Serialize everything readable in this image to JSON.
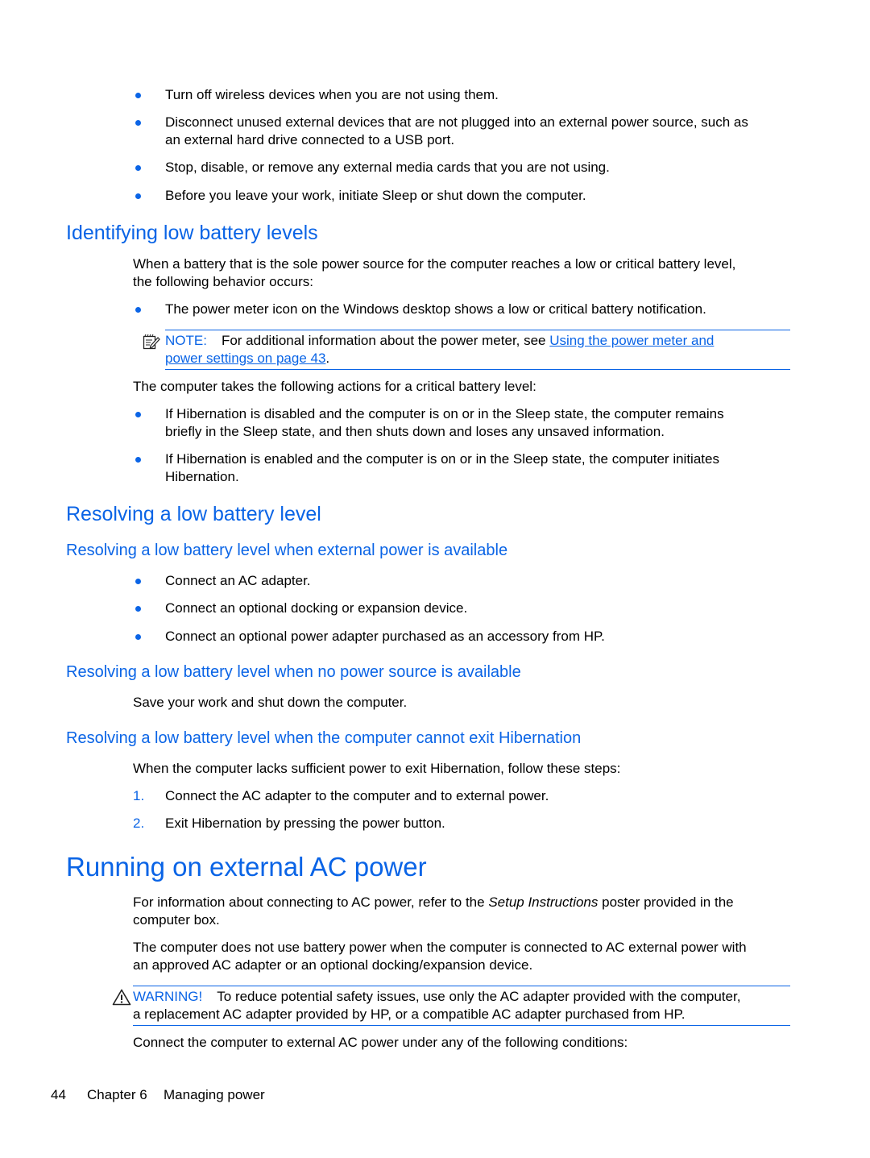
{
  "top_bullets": [
    {
      "lines": [
        "Turn off wireless devices when you are not using them."
      ]
    },
    {
      "lines": [
        "Disconnect unused external devices that are not plugged into an external power source, such as",
        "an external hard drive connected to a USB port."
      ]
    },
    {
      "lines": [
        "Stop, disable, or remove any external media cards that you are not using."
      ]
    },
    {
      "lines": [
        "Before you leave your work, initiate Sleep or shut down the computer."
      ]
    }
  ],
  "section_identifying": {
    "heading": "Identifying low battery levels",
    "intro_lines": [
      "When a battery that is the sole power source for the computer reaches a low or critical battery level,",
      "the following behavior occurs:"
    ],
    "bullets": [
      {
        "lines": [
          "The power meter icon on the Windows desktop shows a low or critical battery notification."
        ]
      }
    ],
    "note": {
      "icon": "note-pencil-icon",
      "label": "NOTE:",
      "text": "For additional information about the power meter, see ",
      "link_line1": "Using the power meter and",
      "link_line2": "power settings on page 43",
      "trailing": "."
    },
    "critical_intro": "The computer takes the following actions for a critical battery level:",
    "critical_bullets": [
      {
        "lines": [
          "If Hibernation is disabled and the computer is on or in the Sleep state, the computer remains",
          "briefly in the Sleep state, and then shuts down and loses any unsaved information."
        ]
      },
      {
        "lines": [
          "If Hibernation is enabled and the computer is on or in the Sleep state, the computer initiates",
          "Hibernation."
        ]
      }
    ]
  },
  "section_resolving": {
    "heading": "Resolving a low battery level",
    "sub_external": {
      "heading": "Resolving a low battery level when external power is available",
      "bullets": [
        {
          "lines": [
            "Connect an AC adapter."
          ]
        },
        {
          "lines": [
            "Connect an optional docking or expansion device."
          ]
        },
        {
          "lines": [
            "Connect an optional power adapter purchased as an accessory from HP."
          ]
        }
      ]
    },
    "sub_no_power": {
      "heading": "Resolving a low battery level when no power source is available",
      "text": "Save your work and shut down the computer."
    },
    "sub_hibernation": {
      "heading": "Resolving a low battery level when the computer cannot exit Hibernation",
      "intro": "When the computer lacks sufficient power to exit Hibernation, follow these steps:",
      "steps": [
        {
          "num": "1.",
          "text": "Connect the AC adapter to the computer and to external power."
        },
        {
          "num": "2.",
          "text": "Exit Hibernation by pressing the power button."
        }
      ]
    }
  },
  "section_ac": {
    "heading": "Running on external AC power",
    "para1_pre": "For information about connecting to AC power, refer to the ",
    "para1_italic": "Setup Instructions",
    "para1_post": " poster provided in the",
    "para1_line2": "computer box.",
    "para2_lines": [
      "The computer does not use battery power when the computer is connected to AC external power with",
      "an approved AC adapter or an optional docking/expansion device."
    ],
    "warning": {
      "icon": "warning-triangle-icon",
      "label": "WARNING!",
      "line1": "To reduce potential safety issues, use only the AC adapter provided with the computer,",
      "line2": "a replacement AC adapter provided by HP, or a compatible AC adapter purchased from HP."
    },
    "para3": "Connect the computer to external AC power under any of the following conditions:"
  },
  "footer": {
    "page_number": "44",
    "chapter": "Chapter 6",
    "chapter_title": "Managing power"
  },
  "colors": {
    "accent": "#0a64e6",
    "text": "#000000"
  }
}
